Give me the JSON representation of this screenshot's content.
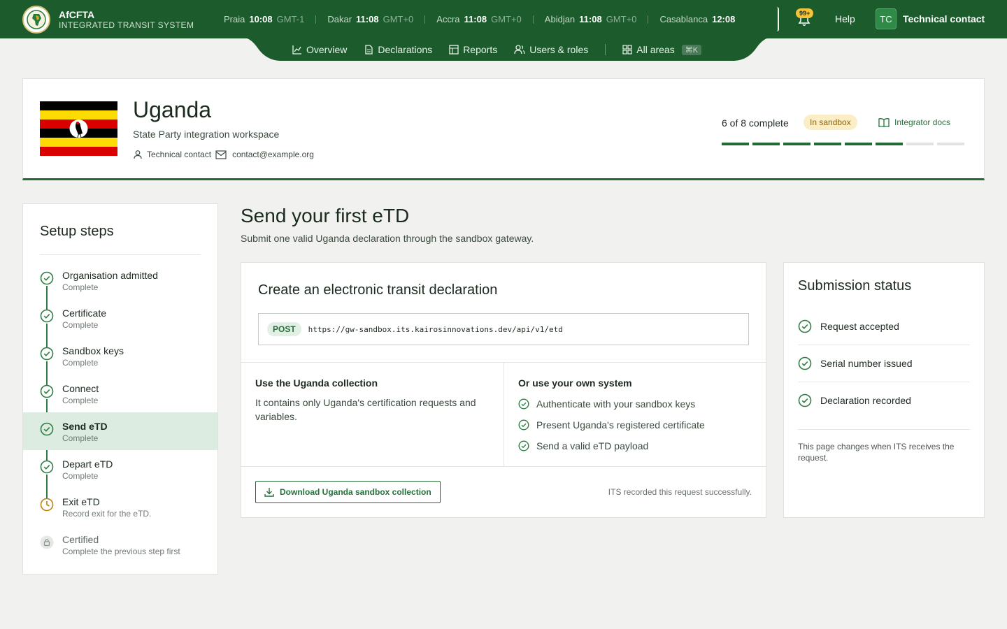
{
  "brand": {
    "name": "AfCFTA",
    "subtitle": "INTEGRATED TRANSIT SYSTEM"
  },
  "clocks": [
    {
      "city": "Praia",
      "time": "10:08",
      "tz": "GMT-1"
    },
    {
      "city": "Dakar",
      "time": "11:08",
      "tz": "GMT+0"
    },
    {
      "city": "Accra",
      "time": "11:08",
      "tz": "GMT+0"
    },
    {
      "city": "Abidjan",
      "time": "11:08",
      "tz": "GMT+0"
    },
    {
      "city": "Casablanca",
      "time": "12:08",
      "tz": ""
    }
  ],
  "topbar": {
    "notifications": "99+",
    "help": "Help",
    "user_initials": "TC",
    "user_name": "Technical contact"
  },
  "nav": {
    "overview": "Overview",
    "declarations": "Declarations",
    "reports": "Reports",
    "users": "Users & roles",
    "all_areas": "All areas",
    "all_areas_kbd": "⌘K"
  },
  "workspace": {
    "country": "Uganda",
    "subtitle": "State Party integration workspace",
    "contact_name": "Technical contact",
    "contact_email": "contact@example.org",
    "progress_text": "6 of 8 complete",
    "progress_done": 6,
    "progress_total": 8,
    "env_badge": "In sandbox",
    "docs_link": "Integrator docs",
    "colors": {
      "accent": "#226b35",
      "header": "#1c5c2c",
      "badge_bg": "#fbeec4"
    }
  },
  "sidebar": {
    "title": "Setup steps",
    "steps": [
      {
        "label": "Organisation admitted",
        "sub": "Complete",
        "state": "done"
      },
      {
        "label": "Certificate",
        "sub": "Complete",
        "state": "done"
      },
      {
        "label": "Sandbox keys",
        "sub": "Complete",
        "state": "done"
      },
      {
        "label": "Connect",
        "sub": "Complete",
        "state": "done"
      },
      {
        "label": "Send eTD",
        "sub": "Complete",
        "state": "active"
      },
      {
        "label": "Depart eTD",
        "sub": "Complete",
        "state": "done"
      },
      {
        "label": "Exit eTD",
        "sub": "Record exit for the eTD.",
        "state": "pending"
      },
      {
        "label": "Certified",
        "sub": "Complete the previous step first",
        "state": "locked"
      }
    ]
  },
  "main": {
    "title": "Send your first eTD",
    "subtitle": "Submit one valid Uganda declaration through the sandbox gateway.",
    "card_title": "Create an electronic transit declaration",
    "method": "POST",
    "url": "https://gw-sandbox.its.kairosinnovations.dev/api/v1/etd",
    "collection_heading": "Use the Uganda collection",
    "collection_text": "It contains only Uganda's certification requests and variables.",
    "own_heading": "Or use your own system",
    "own_items": [
      "Authenticate with your sandbox keys",
      "Present Uganda's registered certificate",
      "Send a valid eTD payload"
    ],
    "download_label": "Download Uganda sandbox collection",
    "recorded_text": "ITS recorded this request successfully."
  },
  "status": {
    "title": "Submission status",
    "items": [
      "Request accepted",
      "Serial number issued",
      "Declaration recorded"
    ],
    "note": "This page changes when ITS receives the request."
  }
}
